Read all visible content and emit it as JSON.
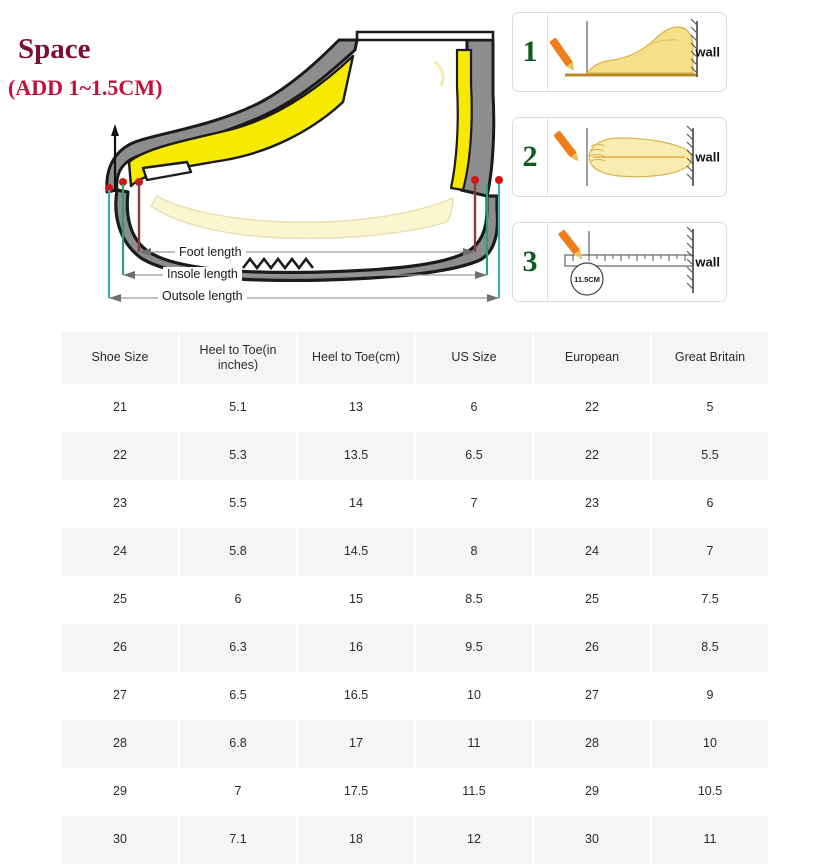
{
  "diagram": {
    "space_title": "Space",
    "space_subtitle": "(ADD 1~1.5CM)",
    "measurements": [
      {
        "name": "foot-length",
        "label": "Foot length"
      },
      {
        "name": "insole-length",
        "label": "Insole length"
      },
      {
        "name": "outsole-length",
        "label": "Outsole length"
      }
    ],
    "colors": {
      "space_title": "#7b1030",
      "space_subtitle": "#c2103c",
      "shoe_upper": "#8d8d8d",
      "insole_yellow": "#f5ea00",
      "foot_cream": "#fbf6d0",
      "foot_length_line": "#8c3a3a",
      "insole_length_line": "#2e9e6b",
      "outsole_length_line": "#4aa8b8"
    }
  },
  "instructions": {
    "wall_label": "wall",
    "panels": [
      {
        "number": "1",
        "view": "side-view",
        "measure_label": ""
      },
      {
        "number": "2",
        "view": "top-view",
        "measure_label": ""
      },
      {
        "number": "3",
        "view": "ruler-view",
        "measure_label": "11.5CM"
      }
    ],
    "numeral_color": "#0d5c1e",
    "pencil_color": "#f07d1b"
  },
  "table": {
    "headers": [
      "Shoe Size",
      "Heel to Toe(in inches)",
      "Heel to Toe(cm)",
      "US Size",
      "European",
      "Great Britain"
    ],
    "rows": [
      [
        "21",
        "5.1",
        "13",
        "6",
        "22",
        "5"
      ],
      [
        "22",
        "5.3",
        "13.5",
        "6.5",
        "22",
        "5.5"
      ],
      [
        "23",
        "5.5",
        "14",
        "7",
        "23",
        "6"
      ],
      [
        "24",
        "5.8",
        "14.5",
        "8",
        "24",
        "7"
      ],
      [
        "25",
        "6",
        "15",
        "8.5",
        "25",
        "7.5"
      ],
      [
        "26",
        "6.3",
        "16",
        "9.5",
        "26",
        "8.5"
      ],
      [
        "27",
        "6.5",
        "16.5",
        "10",
        "27",
        "9"
      ],
      [
        "28",
        "6.8",
        "17",
        "11",
        "28",
        "10"
      ],
      [
        "29",
        "7",
        "17.5",
        "11.5",
        "29",
        "10.5"
      ],
      [
        "30",
        "7.1",
        "18",
        "12",
        "30",
        "11"
      ]
    ],
    "colors": {
      "header_bg": "#f5f5f5",
      "even_row_bg": "#f5f5f5",
      "odd_row_bg": "#ffffff",
      "text": "#2b2b2b"
    }
  }
}
